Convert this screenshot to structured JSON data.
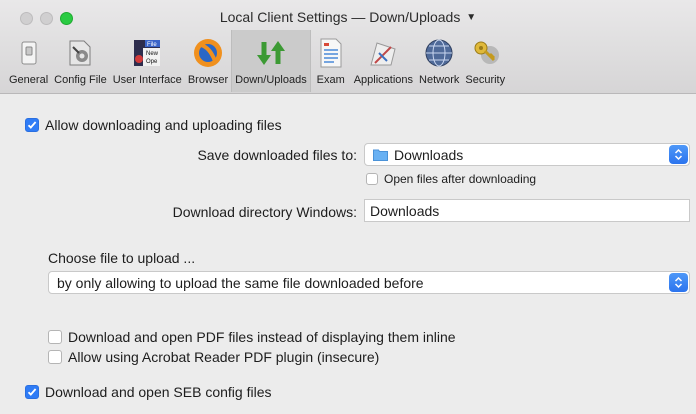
{
  "window": {
    "title": "Local Client Settings",
    "title_sep": "—",
    "title_section": "Down/Uploads"
  },
  "toolbar": {
    "items": [
      {
        "label": "General",
        "icon": "switch-icon"
      },
      {
        "label": "Config File",
        "icon": "config-file-icon"
      },
      {
        "label": "User Interface",
        "icon": "user-interface-icon"
      },
      {
        "label": "Browser",
        "icon": "browser-icon"
      },
      {
        "label": "Down/Uploads",
        "icon": "down-uploads-icon",
        "active": true
      },
      {
        "label": "Exam",
        "icon": "exam-icon"
      },
      {
        "label": "Applications",
        "icon": "applications-icon"
      },
      {
        "label": "Network",
        "icon": "network-icon"
      },
      {
        "label": "Security",
        "icon": "security-icon"
      }
    ],
    "ui_icon_text_1": "File",
    "ui_icon_text_2": "New",
    "ui_icon_text_3": "Ope"
  },
  "downloads": {
    "allow_label": "Allow downloading and uploading files",
    "allow_checked": true,
    "save_label": "Save downloaded files to:",
    "save_value": "Downloads",
    "open_after_label": "Open files after downloading",
    "open_after_checked": false,
    "windows_dir_label": "Download directory Windows:",
    "windows_dir_value": "Downloads",
    "choose_upload_label": "Choose file to upload ...",
    "choose_upload_value": "by only allowing to upload the same file downloaded before",
    "pdf_label": "Download and open PDF files instead of displaying them inline",
    "pdf_checked": false,
    "acrobat_label": "Allow using Acrobat Reader PDF plugin (insecure)",
    "acrobat_checked": false,
    "seb_label": "Download and open SEB config files",
    "seb_checked": true
  },
  "colors": {
    "accent": "#2f7cf6",
    "active_tab_bg": "#cbcbcb"
  }
}
